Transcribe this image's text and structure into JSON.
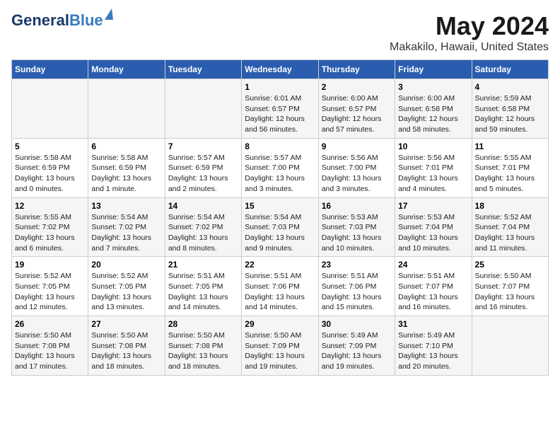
{
  "header": {
    "logo_general": "General",
    "logo_blue": "Blue",
    "title": "May 2024",
    "subtitle": "Makakilo, Hawaii, United States"
  },
  "days_of_week": [
    "Sunday",
    "Monday",
    "Tuesday",
    "Wednesday",
    "Thursday",
    "Friday",
    "Saturday"
  ],
  "weeks": [
    [
      {
        "day": "",
        "info": ""
      },
      {
        "day": "",
        "info": ""
      },
      {
        "day": "",
        "info": ""
      },
      {
        "day": "1",
        "info": "Sunrise: 6:01 AM\nSunset: 6:57 PM\nDaylight: 12 hours\nand 56 minutes."
      },
      {
        "day": "2",
        "info": "Sunrise: 6:00 AM\nSunset: 6:57 PM\nDaylight: 12 hours\nand 57 minutes."
      },
      {
        "day": "3",
        "info": "Sunrise: 6:00 AM\nSunset: 6:58 PM\nDaylight: 12 hours\nand 58 minutes."
      },
      {
        "day": "4",
        "info": "Sunrise: 5:59 AM\nSunset: 6:58 PM\nDaylight: 12 hours\nand 59 minutes."
      }
    ],
    [
      {
        "day": "5",
        "info": "Sunrise: 5:58 AM\nSunset: 6:59 PM\nDaylight: 13 hours\nand 0 minutes."
      },
      {
        "day": "6",
        "info": "Sunrise: 5:58 AM\nSunset: 6:59 PM\nDaylight: 13 hours\nand 1 minute."
      },
      {
        "day": "7",
        "info": "Sunrise: 5:57 AM\nSunset: 6:59 PM\nDaylight: 13 hours\nand 2 minutes."
      },
      {
        "day": "8",
        "info": "Sunrise: 5:57 AM\nSunset: 7:00 PM\nDaylight: 13 hours\nand 3 minutes."
      },
      {
        "day": "9",
        "info": "Sunrise: 5:56 AM\nSunset: 7:00 PM\nDaylight: 13 hours\nand 3 minutes."
      },
      {
        "day": "10",
        "info": "Sunrise: 5:56 AM\nSunset: 7:01 PM\nDaylight: 13 hours\nand 4 minutes."
      },
      {
        "day": "11",
        "info": "Sunrise: 5:55 AM\nSunset: 7:01 PM\nDaylight: 13 hours\nand 5 minutes."
      }
    ],
    [
      {
        "day": "12",
        "info": "Sunrise: 5:55 AM\nSunset: 7:02 PM\nDaylight: 13 hours\nand 6 minutes."
      },
      {
        "day": "13",
        "info": "Sunrise: 5:54 AM\nSunset: 7:02 PM\nDaylight: 13 hours\nand 7 minutes."
      },
      {
        "day": "14",
        "info": "Sunrise: 5:54 AM\nSunset: 7:02 PM\nDaylight: 13 hours\nand 8 minutes."
      },
      {
        "day": "15",
        "info": "Sunrise: 5:54 AM\nSunset: 7:03 PM\nDaylight: 13 hours\nand 9 minutes."
      },
      {
        "day": "16",
        "info": "Sunrise: 5:53 AM\nSunset: 7:03 PM\nDaylight: 13 hours\nand 10 minutes."
      },
      {
        "day": "17",
        "info": "Sunrise: 5:53 AM\nSunset: 7:04 PM\nDaylight: 13 hours\nand 10 minutes."
      },
      {
        "day": "18",
        "info": "Sunrise: 5:52 AM\nSunset: 7:04 PM\nDaylight: 13 hours\nand 11 minutes."
      }
    ],
    [
      {
        "day": "19",
        "info": "Sunrise: 5:52 AM\nSunset: 7:05 PM\nDaylight: 13 hours\nand 12 minutes."
      },
      {
        "day": "20",
        "info": "Sunrise: 5:52 AM\nSunset: 7:05 PM\nDaylight: 13 hours\nand 13 minutes."
      },
      {
        "day": "21",
        "info": "Sunrise: 5:51 AM\nSunset: 7:05 PM\nDaylight: 13 hours\nand 14 minutes."
      },
      {
        "day": "22",
        "info": "Sunrise: 5:51 AM\nSunset: 7:06 PM\nDaylight: 13 hours\nand 14 minutes."
      },
      {
        "day": "23",
        "info": "Sunrise: 5:51 AM\nSunset: 7:06 PM\nDaylight: 13 hours\nand 15 minutes."
      },
      {
        "day": "24",
        "info": "Sunrise: 5:51 AM\nSunset: 7:07 PM\nDaylight: 13 hours\nand 16 minutes."
      },
      {
        "day": "25",
        "info": "Sunrise: 5:50 AM\nSunset: 7:07 PM\nDaylight: 13 hours\nand 16 minutes."
      }
    ],
    [
      {
        "day": "26",
        "info": "Sunrise: 5:50 AM\nSunset: 7:08 PM\nDaylight: 13 hours\nand 17 minutes."
      },
      {
        "day": "27",
        "info": "Sunrise: 5:50 AM\nSunset: 7:08 PM\nDaylight: 13 hours\nand 18 minutes."
      },
      {
        "day": "28",
        "info": "Sunrise: 5:50 AM\nSunset: 7:08 PM\nDaylight: 13 hours\nand 18 minutes."
      },
      {
        "day": "29",
        "info": "Sunrise: 5:50 AM\nSunset: 7:09 PM\nDaylight: 13 hours\nand 19 minutes."
      },
      {
        "day": "30",
        "info": "Sunrise: 5:49 AM\nSunset: 7:09 PM\nDaylight: 13 hours\nand 19 minutes."
      },
      {
        "day": "31",
        "info": "Sunrise: 5:49 AM\nSunset: 7:10 PM\nDaylight: 13 hours\nand 20 minutes."
      },
      {
        "day": "",
        "info": ""
      }
    ]
  ]
}
